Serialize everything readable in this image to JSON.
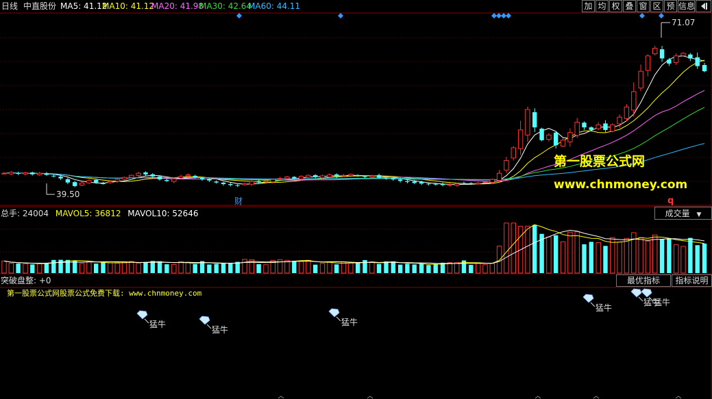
{
  "toolbar": {
    "period": "日线",
    "stock_name": "中直股份",
    "ma": [
      {
        "label": "MA5: 41.12",
        "color": "#ffffff"
      },
      {
        "label": "MA10: 41.12",
        "color": "#ffff00"
      },
      {
        "label": "MA20: 41.98",
        "color": "#ff66ff"
      },
      {
        "label": "MA30: 42.64",
        "color": "#33dd33"
      },
      {
        "label": "MA60: 44.11",
        "color": "#33bbff"
      }
    ],
    "buttons": [
      "加",
      "均",
      "权",
      "叠",
      "窗",
      "区",
      "预",
      "信息"
    ]
  },
  "price_panel": {
    "high_label": "71.07",
    "low_label": "39.50",
    "cai_label": "财",
    "q_label": "q",
    "watermark_name": "第一股票公式网",
    "watermark_url": "www.chnmoney.com"
  },
  "volume_panel": {
    "header": {
      "total": "总手: 24004",
      "mavol5": "MAVOL5: 36812",
      "mavol10": "MAVOL10: 52646"
    },
    "dropdown": "成交量"
  },
  "indicator_panel": {
    "title": "突破盘整: +0",
    "subtitle": "第一股票公式网股票公式免费下载: www.chnmoney.com",
    "btn_best": "最优指标",
    "btn_explain": "指标说明",
    "signal_label": "猛牛"
  },
  "colors": {
    "up": "#ff3333",
    "down": "#55ffff",
    "ma5": "#ffffff",
    "ma10": "#ffff00",
    "ma20": "#ff66ff",
    "ma30": "#33dd33",
    "ma60": "#33bbff",
    "signal": "#ccecff",
    "subtitle": "#ffff33",
    "diamond": "#3399ff"
  },
  "chart_data": {
    "type": "candlestick",
    "price_range": [
      36,
      73
    ],
    "closes": [
      42.0,
      42.2,
      41.9,
      42.1,
      41.8,
      42.0,
      41.7,
      41.5,
      41.0,
      40.2,
      39.5,
      40.1,
      40.6,
      40.2,
      40.0,
      40.4,
      40.8,
      41.2,
      41.6,
      42.0,
      41.8,
      41.4,
      40.8,
      40.5,
      40.9,
      41.4,
      41.7,
      41.2,
      40.8,
      40.6,
      40.2,
      39.9,
      39.7,
      39.6,
      40.0,
      40.4,
      40.2,
      40.5,
      40.8,
      41.0,
      41.3,
      41.0,
      41.4,
      41.6,
      41.3,
      41.5,
      41.7,
      41.4,
      41.6,
      41.8,
      41.5,
      41.3,
      41.5,
      41.2,
      41.0,
      40.8,
      40.5,
      40.3,
      40.1,
      40.0,
      39.9,
      39.8,
      39.7,
      39.8,
      39.9,
      40.0,
      39.9,
      40.1,
      40.3,
      40.8,
      42.0,
      44.5,
      47.0,
      50.5,
      54.5,
      51.0,
      48.5,
      49.5,
      47.5,
      48.5,
      50.0,
      52.0,
      51.0,
      50.5,
      51.5,
      50.5,
      51.5,
      53.0,
      55.0,
      58.0,
      62.0,
      65.0,
      66.5,
      64.5,
      63.5,
      65.0,
      65.5,
      64.5,
      63.0,
      62.0
    ],
    "ma_values": {
      "MA5": 41.12,
      "MA10": 41.12,
      "MA20": 41.98,
      "MA30": 42.64,
      "MA60": 44.11
    },
    "volume_header": {
      "总手": 24004,
      "MAVOL5": 36812,
      "MAVOL10": 52646
    },
    "signal_bars": [
      27,
      39,
      65,
      115,
      124,
      126
    ]
  }
}
